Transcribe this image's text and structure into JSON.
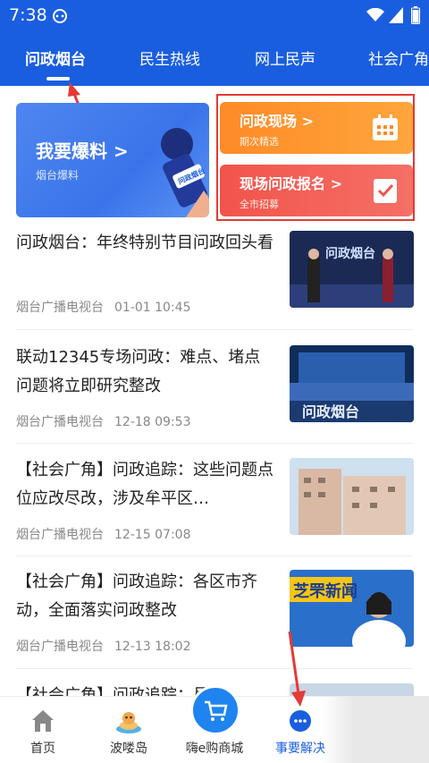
{
  "status_bar": {
    "time": "7:38"
  },
  "tabs": [
    {
      "label": "问政烟台",
      "active": true
    },
    {
      "label": "民生热线",
      "active": false
    },
    {
      "label": "网上民声",
      "active": false
    },
    {
      "label": "社会广角",
      "active": false
    }
  ],
  "banner": {
    "main_title": "我要爆料 >",
    "main_sub": "烟台爆料",
    "mic_label": "问政烟台",
    "cards": [
      {
        "title": "问政现场 >",
        "sub": "期次精选",
        "icon": "calendar-icon"
      },
      {
        "title": "现场问政报名 >",
        "sub": "全市招募",
        "icon": "checkbox-icon"
      }
    ]
  },
  "news": [
    {
      "title": "问政烟台：年终特别节目问政回头看",
      "source": "烟台广播电视台",
      "date": "01-01 10:45",
      "thumb_text": "问政烟台"
    },
    {
      "title": "联动12345专场问政：难点、堵点问题将立即研究整改",
      "source": "烟台广播电视台",
      "date": "12-18 09:53",
      "thumb_text": "问政烟台"
    },
    {
      "title": "【社会广角】问政追踪：这些问题点位应改尽改，涉及牟平区…",
      "source": "烟台广播电视台",
      "date": "12-15 07:08",
      "thumb_text": ""
    },
    {
      "title": "【社会广角】问政追踪：各区市齐动，全面落实问政整改",
      "source": "烟台广播电视台",
      "date": "12-13 18:02",
      "thumb_text": "芝罘新闻"
    },
    {
      "title": "【社会广角】问政追踪：尽解",
      "source": "",
      "date": "",
      "thumb_text": ""
    }
  ],
  "bottom_nav": [
    {
      "label": "首页",
      "icon": "home-icon",
      "active": false
    },
    {
      "label": "波喽岛",
      "icon": "island-icon",
      "active": false
    },
    {
      "label": "嗨e购商城",
      "icon": "shopping-cart-icon",
      "active": false
    },
    {
      "label": "事要解决",
      "icon": "chat-bubble-icon",
      "active": true
    }
  ],
  "colors": {
    "brand_blue": "#1a5ee0",
    "orange_card": "#ff8a28",
    "red_card": "#f2544b",
    "annotation_red": "#e53935"
  }
}
